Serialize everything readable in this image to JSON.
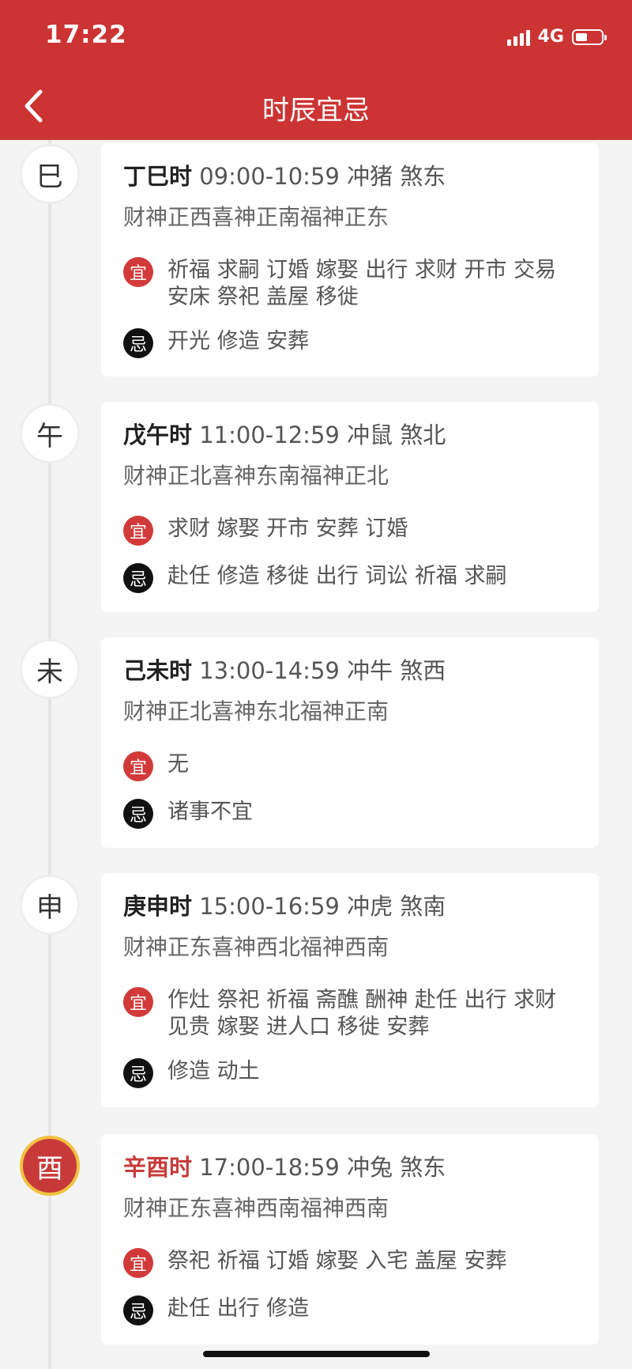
{
  "status_bar": {
    "time": "17:22",
    "network": "4G"
  },
  "header": {
    "title": "时辰宜忌",
    "back_icon": "chevron-left-icon"
  },
  "labels": {
    "yi": "宜",
    "ji": "忌"
  },
  "hours": [
    {
      "node": "巳",
      "name": "丁巳时",
      "detail": " 09:00-10:59 冲猪 煞东",
      "gods": "财神正西喜神正南福神正东",
      "yi": "祈福 求嗣 订婚 嫁娶 出行 求财 开市 交易 安床 祭祀 盖屋 移徙",
      "ji": "开光 修造 安葬",
      "active": false
    },
    {
      "node": "午",
      "name": "戊午时",
      "detail": " 11:00-12:59 冲鼠 煞北",
      "gods": "财神正北喜神东南福神正北",
      "yi": "求财 嫁娶 开市 安葬 订婚",
      "ji": "赴任 修造 移徙 出行 词讼 祈福 求嗣",
      "active": false
    },
    {
      "node": "未",
      "name": "己未时",
      "detail": " 13:00-14:59 冲牛 煞西",
      "gods": "财神正北喜神东北福神正南",
      "yi": "无",
      "ji": "诸事不宜",
      "active": false
    },
    {
      "node": "申",
      "name": "庚申时",
      "detail": " 15:00-16:59 冲虎 煞南",
      "gods": "财神正东喜神西北福神西南",
      "yi": "作灶 祭祀 祈福 斋醮 酬神 赴任 出行 求财 见贵 嫁娶 进人口 移徙 安葬",
      "ji": "修造 动土",
      "active": false
    },
    {
      "node": "酉",
      "name": "辛酉时",
      "detail": " 17:00-18:59 冲兔 煞东",
      "gods": "财神正东喜神西南福神西南",
      "yi": "祭祀 祈福 订婚 嫁娶 入宅 盖屋 安葬",
      "ji": "赴任 出行 修造",
      "active": true
    }
  ]
}
